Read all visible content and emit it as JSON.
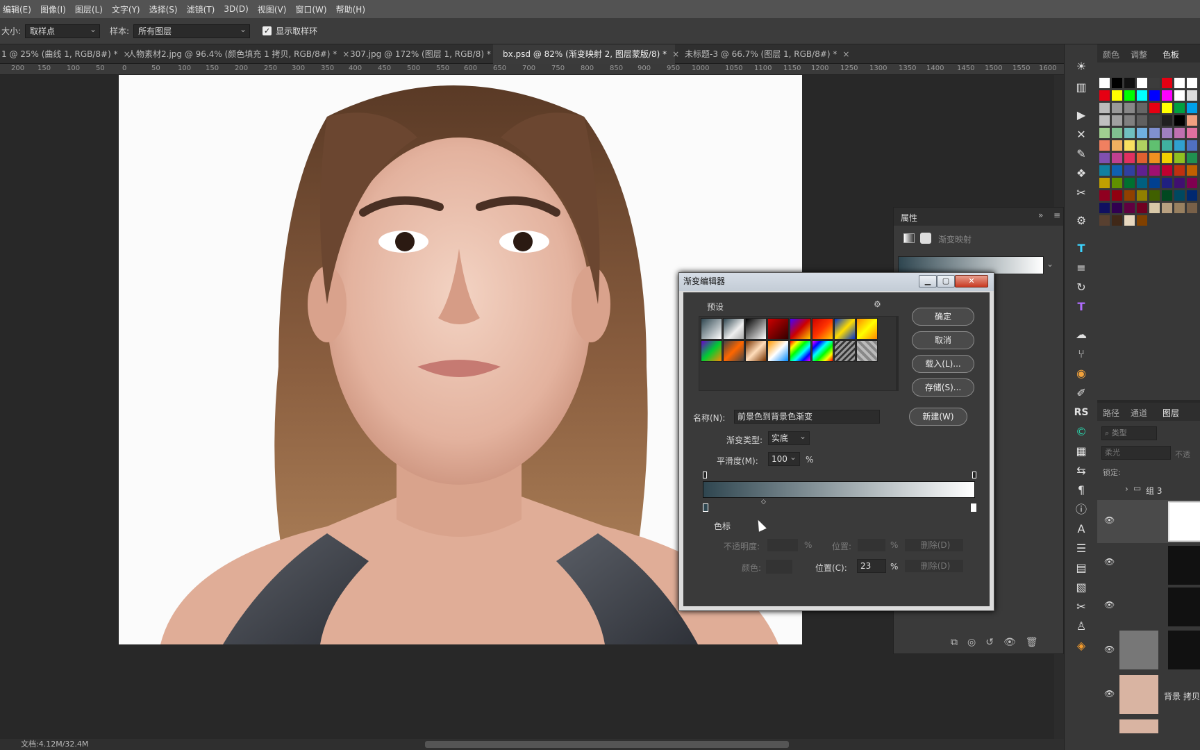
{
  "menu": [
    "编辑(E)",
    "图像(I)",
    "图层(L)",
    "文字(Y)",
    "选择(S)",
    "滤镜(T)",
    "3D(D)",
    "视图(V)",
    "窗口(W)",
    "帮助(H)"
  ],
  "options": {
    "size_label": "大小:",
    "size_value": "取样点",
    "sample_label": "样本:",
    "sample_value": "所有图层",
    "show_ring_label": "显示取样环"
  },
  "tabs": [
    "1 @ 25% (曲线 1, RGB/8#) *",
    "人物素材2.jpg @ 96.4% (颜色填充 1 拷贝, RGB/8#) *",
    "307.jpg @ 172% (图层 1, RGB/8) *",
    "bx.psd @ 82% (渐变映射 2, 图层蒙版/8) *",
    "未标题-3 @ 66.7% (图层 1, RGB/8#) *"
  ],
  "ruler": [
    "200",
    "150",
    "100",
    "50",
    "0",
    "50",
    "100",
    "150",
    "200",
    "250",
    "300",
    "350",
    "400",
    "450",
    "500",
    "550",
    "600",
    "650",
    "700",
    "750",
    "800",
    "850",
    "900",
    "950",
    "1000",
    "1050",
    "1100",
    "1150",
    "1200",
    "1250",
    "1300",
    "1350",
    "1400",
    "1450",
    "1500",
    "1550",
    "1600"
  ],
  "status": "文档:4.12M/32.4M",
  "swatch_tabs": [
    "颜色",
    "调整",
    "色板"
  ],
  "swatch_colors": [
    "#ffffff",
    "#000000",
    "#111111",
    "#ffffff",
    "#3c3c3c",
    "#e60012",
    "#ffffff",
    "#ffffff",
    "#e60012",
    "#ffff00",
    "#00ff00",
    "#00ffff",
    "#0000ff",
    "#ff00ff",
    "#ffffff",
    "#dddddd",
    "#bbbbbb",
    "#999999",
    "#888888",
    "#666666",
    "#e60012",
    "#ffff00",
    "#00a040",
    "#00a0e9",
    "#c0c0c0",
    "#a0a0a0",
    "#808080",
    "#606060",
    "#404040",
    "#202020",
    "#000000",
    "#f0a080",
    "#a0d090",
    "#80c090",
    "#70c0c0",
    "#70b0e0",
    "#8090d0",
    "#a080c0",
    "#c070b0",
    "#e070a0",
    "#f08060",
    "#f0b060",
    "#f8e060",
    "#b0d060",
    "#60c070",
    "#40b0a0",
    "#30a0d0",
    "#5070c0",
    "#8050b0",
    "#c04090",
    "#e03060",
    "#e06030",
    "#f09020",
    "#f0d000",
    "#90c020",
    "#209050",
    "#1080a0",
    "#1060b0",
    "#3040a0",
    "#602090",
    "#a01070",
    "#c00030",
    "#c03010",
    "#c06000",
    "#c0a000",
    "#609000",
    "#007030",
    "#006080",
    "#004090",
    "#202080",
    "#401070",
    "#800050",
    "#900020",
    "#900010",
    "#904000",
    "#908000",
    "#406000",
    "#004820",
    "#004860",
    "#002870",
    "#101060",
    "#300050",
    "#600040",
    "#700020",
    "#d8c8a8",
    "#b8a080",
    "#988060",
    "#786048",
    "#584030",
    "#402818",
    "#e8d8c0",
    "#804000"
  ],
  "properties": {
    "title": "属性",
    "type": "渐变映射"
  },
  "dialog": {
    "title": "渐变编辑器",
    "presets_label": "预设",
    "ok": "确定",
    "cancel": "取消",
    "load": "载入(L)...",
    "save": "存储(S)...",
    "new": "新建(W)",
    "name_label": "名称(N):",
    "name_value": "前景色到背景色渐变",
    "type_label": "渐变类型:",
    "type_value": "实底",
    "smooth_label": "平滑度(M):",
    "smooth_value": "100",
    "pct": "%",
    "stops_label": "色标",
    "opacity_label": "不透明度:",
    "location_label": "位置:",
    "delete_label": "删除(D)",
    "color_label": "颜色:",
    "location_c_label": "位置(C):",
    "location_c_value": "23",
    "gradient_start": "#2f4650",
    "gradient_end": "#ffffff"
  },
  "layers_panel": {
    "tabs": [
      "路径",
      "通道",
      "图层"
    ],
    "filter": "类型",
    "blend": "柔光",
    "opacity": "不透",
    "lock_label": "锁定:",
    "group": "组 3",
    "bg_copy": "背景 拷贝"
  }
}
